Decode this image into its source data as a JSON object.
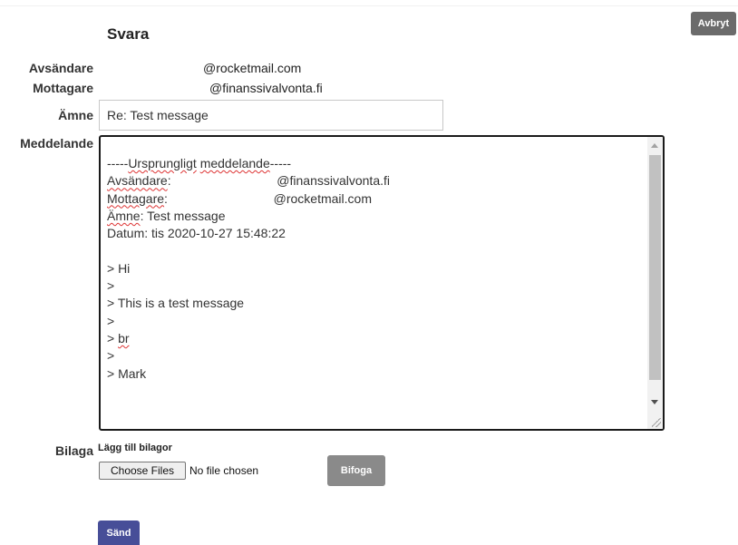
{
  "form": {
    "title": "Svara",
    "cancel_label": "Avbryt",
    "sender_label": "Avsändare",
    "sender_value": "@rocketmail.com",
    "recipient_label": "Mottagare",
    "recipient_value": "@finanssivalvonta.fi",
    "subject_label": "Ämne",
    "subject_value": "Re: Test message",
    "message_label": "Meddelande"
  },
  "message": {
    "original_dash_left": "-----",
    "original_word1": "Ursprungligt",
    "original_word2": "meddelande",
    "original_dash_right": "-----",
    "sender_label": "Avsändare",
    "sender_value": "@finanssivalvonta.fi",
    "recipient_label": "Mottagare",
    "recipient_value": "@rocketmail.com",
    "subject_label": "Ämne",
    "subject_value": ": Test message",
    "date_line": "Datum: tis 2020-10-27 15:48:22",
    "line_hi": "> Hi",
    "line_blank1": ">",
    "line_test": "> This is a test message",
    "line_blank2": ">",
    "line_br_prefix": "> ",
    "line_br_word": "br",
    "line_blank3": ">",
    "line_mark": "> Mark"
  },
  "attachment": {
    "label": "Bilaga",
    "add_label": "Lägg till bilagor",
    "choose_files_label": "Choose Files",
    "file_status": "No file chosen",
    "attach_button": "Bifoga"
  },
  "actions": {
    "send_label": "Sänd"
  }
}
